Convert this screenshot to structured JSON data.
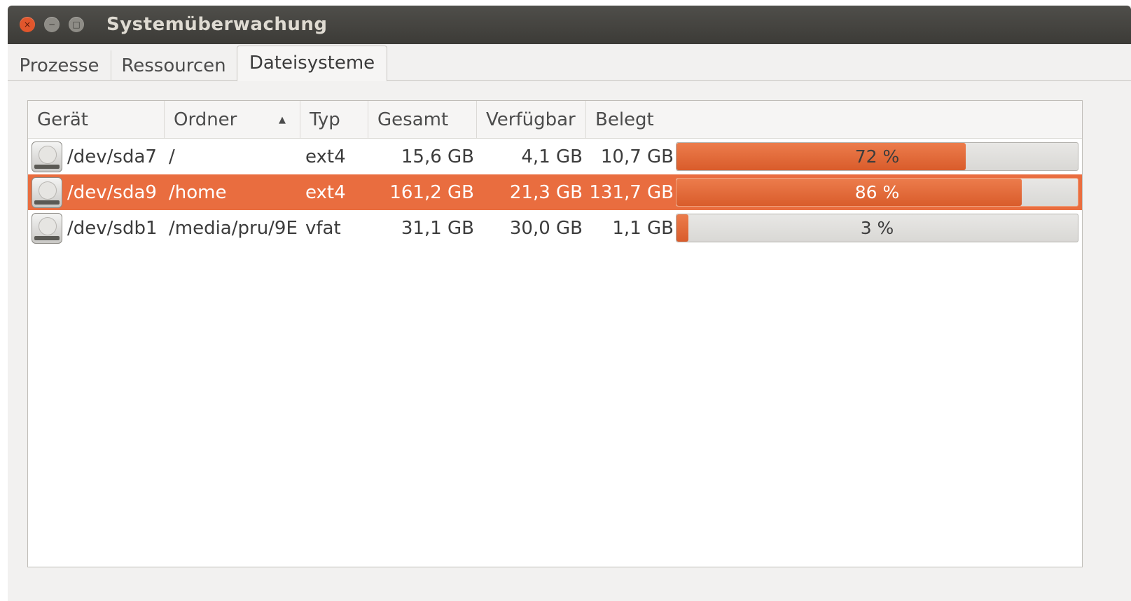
{
  "window": {
    "title": "Systemüberwachung",
    "controls": {
      "close": "×",
      "minimize": "−",
      "maximize": "□"
    }
  },
  "tabs": [
    {
      "label": "Prozesse",
      "active": false
    },
    {
      "label": "Ressourcen",
      "active": false
    },
    {
      "label": "Dateisysteme",
      "active": true
    }
  ],
  "table": {
    "columns": {
      "device": "Gerät",
      "folder": "Ordner",
      "type": "Typ",
      "total": "Gesamt",
      "available": "Verfügbar",
      "used": "Belegt",
      "sort_indicator": "▲"
    },
    "rows": [
      {
        "device": "/dev/sda7",
        "folder": "/",
        "type": "ext4",
        "total": "15,6 GB",
        "available": "4,1 GB",
        "used": "10,7 GB",
        "percent_label": "72 %",
        "percent": 72,
        "selected": false
      },
      {
        "device": "/dev/sda9",
        "folder": "/home",
        "type": "ext4",
        "total": "161,2 GB",
        "available": "21,3 GB",
        "used": "131,7 GB",
        "percent_label": "86 %",
        "percent": 86,
        "selected": true
      },
      {
        "device": "/dev/sdb1",
        "folder": "/media/pru/9E",
        "type": "vfat",
        "total": "31,1 GB",
        "available": "30,0 GB",
        "used": "1,1 GB",
        "percent_label": "3 %",
        "percent": 3,
        "selected": false
      }
    ]
  },
  "colors": {
    "accent": "#e96d3f",
    "titlebar": "#3c3b37",
    "close_button": "#e1562c"
  },
  "icons": {
    "drive": "harddisk-icon",
    "sort": "sort-ascending-icon"
  }
}
